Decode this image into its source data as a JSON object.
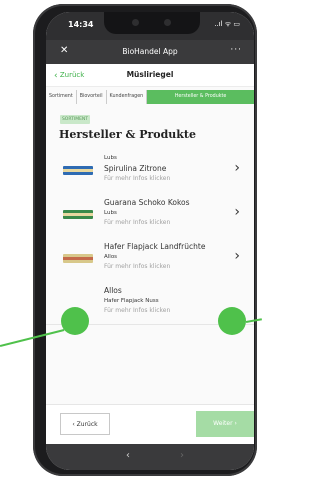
{
  "status_bar": {
    "time": "14:34",
    "system_icons": "..ıl ᯤ ▭"
  },
  "title_bar": {
    "close_label": "✕",
    "title": "BioHandel App",
    "more_label": "···"
  },
  "nav": {
    "back_label": "Zurück",
    "title": "Müsliriegel"
  },
  "tabs": [
    {
      "label": "Sortiment"
    },
    {
      "label": "Biovorteil"
    },
    {
      "label": "Kundenfragen"
    },
    {
      "label": "Hersteller & Produkte"
    }
  ],
  "section": {
    "badge": "SORTIMENT",
    "heading": "Hersteller & Produkte"
  },
  "products": [
    {
      "line1": "Lubs",
      "line2": "Spirulina Zitrone",
      "hint": "Für mehr Infos klicken",
      "chevron": "›"
    },
    {
      "line1": "Guarana Schoko Kokos",
      "line2": "Lubs",
      "hint": "Für mehr Infos klicken",
      "chevron": "›"
    },
    {
      "line1": "Hafer Flapjack Landfrüchte",
      "line2": "Allos",
      "hint": "Für mehr Infos klicken",
      "chevron": "›"
    },
    {
      "line1": "Allos",
      "line2": "Hafer Flapjack Nuss",
      "hint": "Für mehr Infos klicken"
    }
  ],
  "footer": {
    "back_label": "‹ Zurück",
    "next_label": "Weiter ›"
  },
  "bottom_bar": {
    "back_arrow": "‹",
    "forward_arrow": "›"
  },
  "colors": {
    "accent": "#5bbd5f",
    "callout": "#4fc14b",
    "dark_bar": "#3a3a3c"
  }
}
